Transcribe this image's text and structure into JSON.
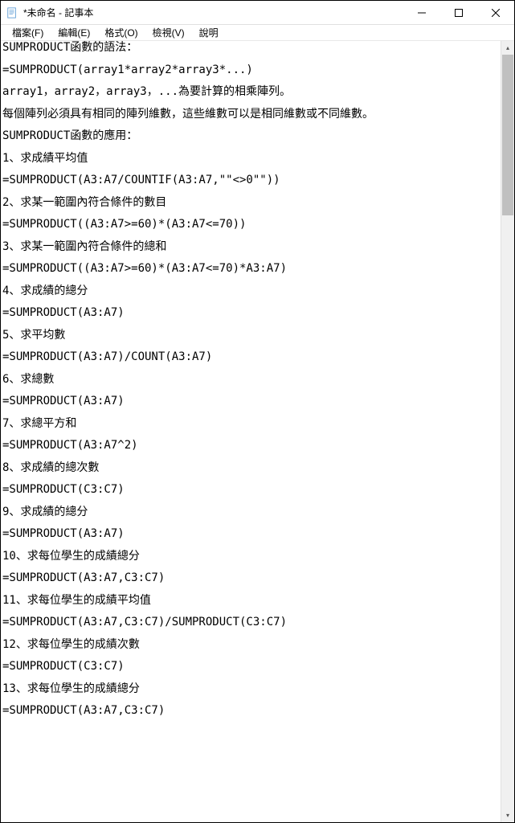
{
  "window": {
    "title": "*未命名 - 記事本"
  },
  "menu": {
    "file": "檔案(F)",
    "edit": "編輯(E)",
    "format": "格式(O)",
    "view": "檢視(V)",
    "help": "說明"
  },
  "content": {
    "lines": [
      "SUMPRODUCT函數的語法：",
      "",
      "=SUMPRODUCT(array1*array2*array3*...)",
      "",
      "array1，array2，array3，...為要計算的相乘陣列。",
      "",
      "每個陣列必須具有相同的陣列維數，這些維數可以是相同維數或不同維數。",
      "",
      "SUMPRODUCT函數的應用：",
      "",
      "1、求成績平均值",
      "",
      "=SUMPRODUCT(A3:A7/COUNTIF(A3:A7,\"\"<>0\"\"))",
      "",
      "2、求某一範圍內符合條件的數目",
      "",
      "=SUMPRODUCT((A3:A7>=60)*(A3:A7<=70))",
      "",
      "3、求某一範圍內符合條件的總和",
      "",
      "=SUMPRODUCT((A3:A7>=60)*(A3:A7<=70)*A3:A7)",
      "",
      "4、求成績的總分",
      "",
      "=SUMPRODUCT(A3:A7)",
      "",
      "5、求平均數",
      "",
      "=SUMPRODUCT(A3:A7)/COUNT(A3:A7)",
      "",
      "6、求總數",
      "",
      "=SUMPRODUCT(A3:A7)",
      "",
      "7、求總平方和",
      "",
      "=SUMPRODUCT(A3:A7^2)",
      "",
      "8、求成績的總次數",
      "",
      "=SUMPRODUCT(C3:C7)",
      "",
      "9、求成績的總分",
      "",
      "=SUMPRODUCT(A3:A7)",
      "",
      "10、求每位學生的成績總分",
      "",
      "=SUMPRODUCT(A3:A7,C3:C7)",
      "",
      "11、求每位學生的成績平均值",
      "",
      "=SUMPRODUCT(A3:A7,C3:C7)/SUMPRODUCT(C3:C7)",
      "",
      "12、求每位學生的成績次數",
      "",
      "=SUMPRODUCT(C3:C7)",
      "",
      "13、求每位學生的成績總分",
      "",
      "=SUMPRODUCT(A3:A7,C3:C7)"
    ]
  }
}
